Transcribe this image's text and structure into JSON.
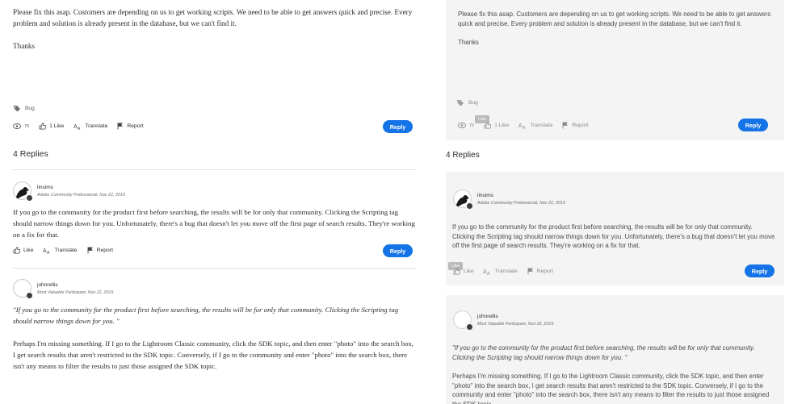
{
  "left": {
    "post": {
      "paragraph_1": "Please fix this asap. Customers are depending on us to get working scripts. We need to be able to get answers quick and precise. Every problem and solution is already present in the database, but we can't find it.",
      "paragraph_2": "Thanks",
      "tag": "Bug",
      "views": "70",
      "like": "1 Like",
      "translate": "Translate",
      "report": "Report",
      "reply": "Reply"
    },
    "replies_heading": "4 Replies",
    "reply1": {
      "author": "linsims",
      "role_date": "Adobe Community Professional, Nov 22, 2019",
      "text": "If you go to the community for the product first before searching, the results will be for only that community. Clicking the Scripting tag should narrow things down for you. Unfortunately, there's a bug that doesn't let you move off the first page of search results. They're working on a fix for that.",
      "like": "Like",
      "translate": "Translate",
      "report": "Report",
      "reply": "Reply"
    },
    "reply2": {
      "author": "johnrellis",
      "role_date": "Most Valuable Participant, Nov 22, 2019",
      "quote": "\"If you go to the community for the product first before searching, the results will be for only that community. Clicking the Scripting tag should narrow things down for you. \"",
      "text": "Perhaps I'm missing something. If I go to the Lightroom Classic community, click the SDK topic, and then enter \"photo\" into the search box, I get search results that aren't restricted to the SDK topic. Conversely, if I go to the community and enter \"photo\" into the search box, there isn't any means to filter the results to just those assigned the SDK topic."
    }
  },
  "right": {
    "post": {
      "paragraph_1": "Please fix this asap. Customers are depending on us to get working scripts. We need to be able to get answers quick and precise. Every problem and solution is already present in the database, but we can't find it.",
      "paragraph_2": "Thanks",
      "tag": "Bug",
      "views": "70",
      "like": "1 Like",
      "like_tooltip": "Like",
      "translate": "Translate",
      "report": "Report",
      "reply": "Reply"
    },
    "replies_heading": "4 Replies",
    "reply1": {
      "author": "linsims",
      "role_date": "Adobe Community Professional, Nov 22, 2019",
      "text": "If you go to the community for the product first before searching, the results will be for only that community. Clicking the Scripting tag should narrow things down for you. Unfortunately, there's a bug that doesn't let you move off the first page of search results. They're working on a fix for that.",
      "like": "Like",
      "like_tooltip": "Like",
      "translate": "Translate",
      "report": "Report",
      "reply": "Reply"
    },
    "reply2": {
      "author": "johnrellis",
      "role_date": "Most Valuable Participant, Nov 22, 2019",
      "quote": "\"If you go to the community for the product first before searching, the results will be for only that community. Clicking the Scripting tag should narrow things down for you. \"",
      "text": "Perhaps I'm missing something. If I go to the Lightroom Classic community, click the SDK topic, and then enter \"photo\" into the search box, I get search results that aren't restricted to the SDK topic. Conversely, if I go to the community and enter \"photo\" into the search box, there isn't any means to filter the results to just those assigned the SDK topic."
    }
  },
  "colors": {
    "accent": "#1473e6",
    "panel_bg": "#f4f4f4",
    "text": "#2c2c2c"
  }
}
